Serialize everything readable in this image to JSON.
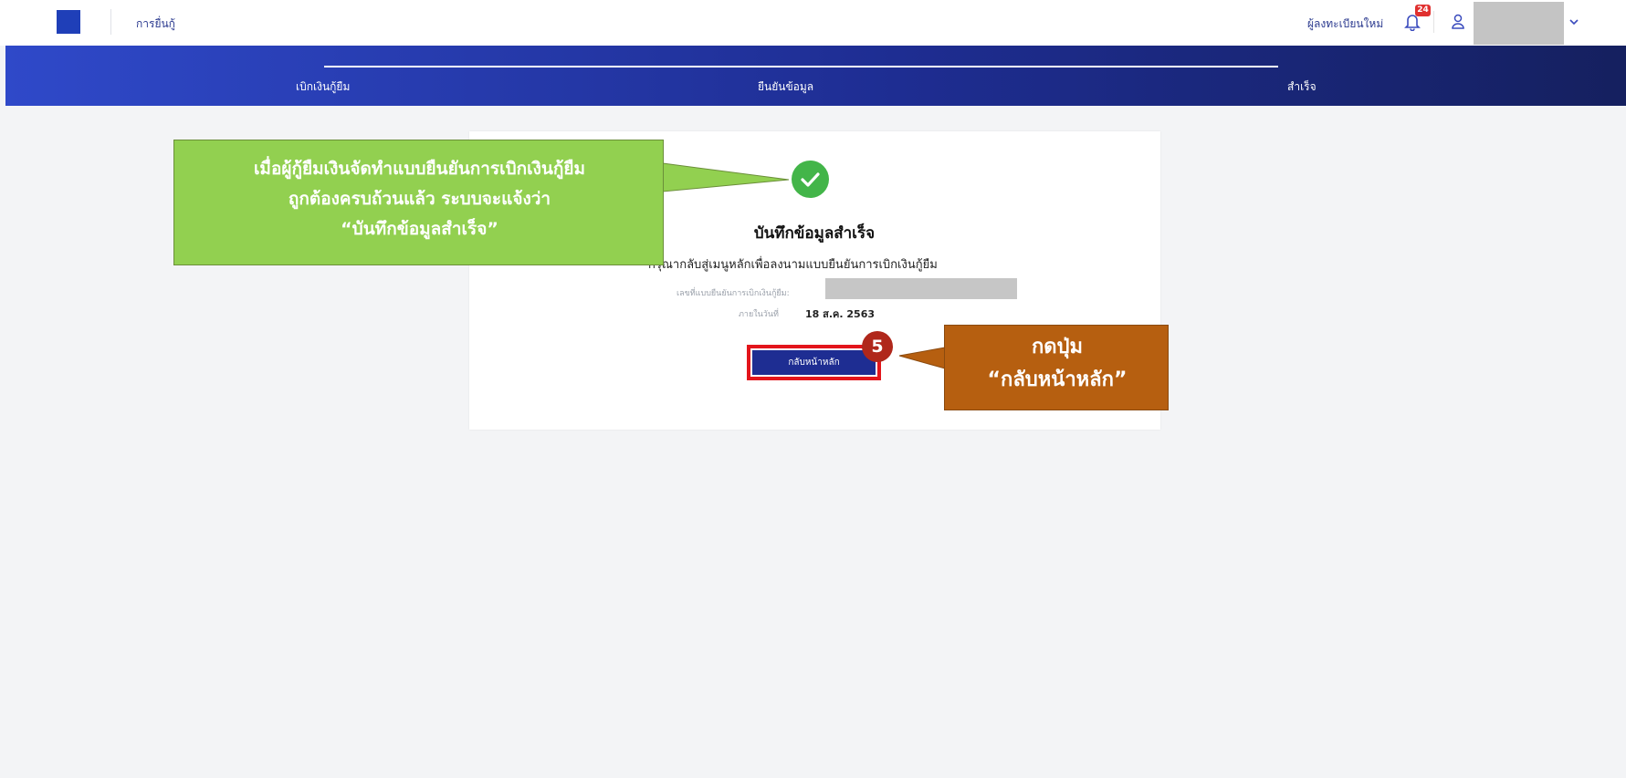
{
  "header": {
    "app_title": "การยื่นกู้",
    "register_link": "ผู้ลงทะเบียนใหม่",
    "notification_count": "24",
    "user_name": "",
    "icons": {
      "bell": "bell-icon",
      "user": "user-icon",
      "dropdown": "chevron-down-icon"
    }
  },
  "stepper": {
    "steps": [
      "เบิกเงินกู้ยืม",
      "ยืนยันข้อมูล",
      "สำเร็จ"
    ]
  },
  "result": {
    "title": "บันทึกข้อมูลสำเร็จ",
    "message": "กรุณากลับสู่เมนูหลักเพื่อลงนามแบบยืนยันการเบิกเงินกู้ยืม",
    "ref_no_label": "เลขที่แบบยืนยันการเบิกเงินกู้ยืม:",
    "ref_no_value": "",
    "date_label": "ภายในวันที่",
    "date_value": "18 ส.ค. 2563",
    "home_button_label": "กลับหน้าหลัก",
    "icon": "check-circle-icon"
  },
  "annotations": {
    "green_note": [
      "เมื่อผู้กู้ยืมเงินจัดทำแบบยืนยันการเบิกเงินกู้ยืม",
      "ถูกต้องครบถ้วนแล้ว ระบบจะแจ้งว่า",
      "“บันทึกข้อมูลสำเร็จ”"
    ],
    "orange_note": [
      "กดปุ่ม",
      "“กลับหน้าหลัก”"
    ],
    "step_number": "5"
  },
  "colors": {
    "brand_blue": "#1e2d92",
    "success_green": "#43b549",
    "highlight_red": "#e3151b",
    "note_green": "#92d050",
    "note_orange": "#b65f10"
  }
}
